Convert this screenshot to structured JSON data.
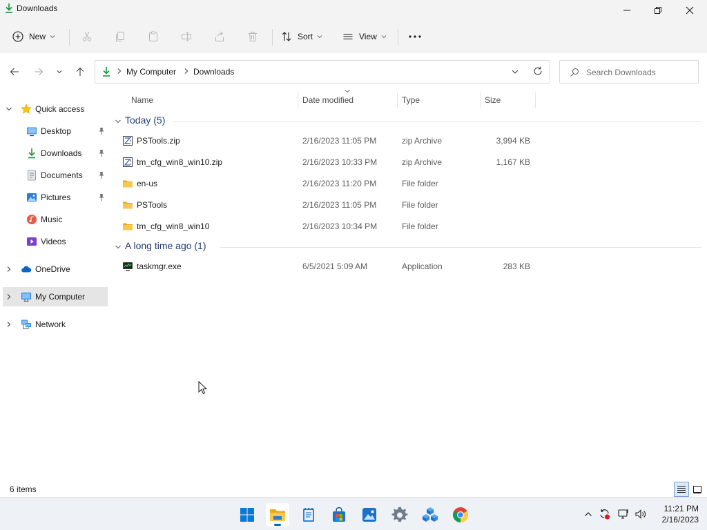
{
  "window": {
    "title": "Downloads"
  },
  "toolbar": {
    "new_label": "New",
    "sort_label": "Sort",
    "view_label": "View"
  },
  "address": {
    "crumbs": [
      "My Computer",
      "Downloads"
    ]
  },
  "search": {
    "placeholder": "Search Downloads"
  },
  "nav": {
    "quick_access": "Quick access",
    "items": [
      {
        "label": "Desktop",
        "icon": "desktop-icon",
        "pinned": true
      },
      {
        "label": "Downloads",
        "icon": "downloads-icon",
        "pinned": true
      },
      {
        "label": "Documents",
        "icon": "documents-icon",
        "pinned": true
      },
      {
        "label": "Pictures",
        "icon": "pictures-icon",
        "pinned": true
      },
      {
        "label": "Music",
        "icon": "music-icon",
        "pinned": false
      },
      {
        "label": "Videos",
        "icon": "videos-icon",
        "pinned": false
      }
    ],
    "onedrive": "OneDrive",
    "my_computer": "My Computer",
    "network": "Network"
  },
  "columns": {
    "name": "Name",
    "date": "Date modified",
    "type": "Type",
    "size": "Size"
  },
  "groups": [
    {
      "label": "Today (5)",
      "files": [
        {
          "name": "PSTools.zip",
          "date": "2/16/2023 11:05 PM",
          "type": "zip Archive",
          "size": "3,994 KB",
          "icon": "zip-icon"
        },
        {
          "name": "tm_cfg_win8_win10.zip",
          "date": "2/16/2023 10:33 PM",
          "type": "zip Archive",
          "size": "1,167 KB",
          "icon": "zip-icon"
        },
        {
          "name": "en-us",
          "date": "2/16/2023 11:20 PM",
          "type": "File folder",
          "size": "",
          "icon": "folder-icon"
        },
        {
          "name": "PSTools",
          "date": "2/16/2023 11:05 PM",
          "type": "File folder",
          "size": "",
          "icon": "folder-icon"
        },
        {
          "name": "tm_cfg_win8_win10",
          "date": "2/16/2023 10:34 PM",
          "type": "File folder",
          "size": "",
          "icon": "folder-icon"
        }
      ]
    },
    {
      "label": "A long time ago (1)",
      "files": [
        {
          "name": "taskmgr.exe",
          "date": "6/5/2021 5:09 AM",
          "type": "Application",
          "size": "283 KB",
          "icon": "exe-icon"
        }
      ]
    }
  ],
  "status": {
    "item_count": "6 items"
  },
  "clock": {
    "time": "11:21 PM",
    "date": "2/16/2023"
  },
  "colors": {
    "accent": "#0067c0",
    "folder": "#f8c84a",
    "selection": "#e5e5e5",
    "group_text": "#1f3d7a"
  }
}
